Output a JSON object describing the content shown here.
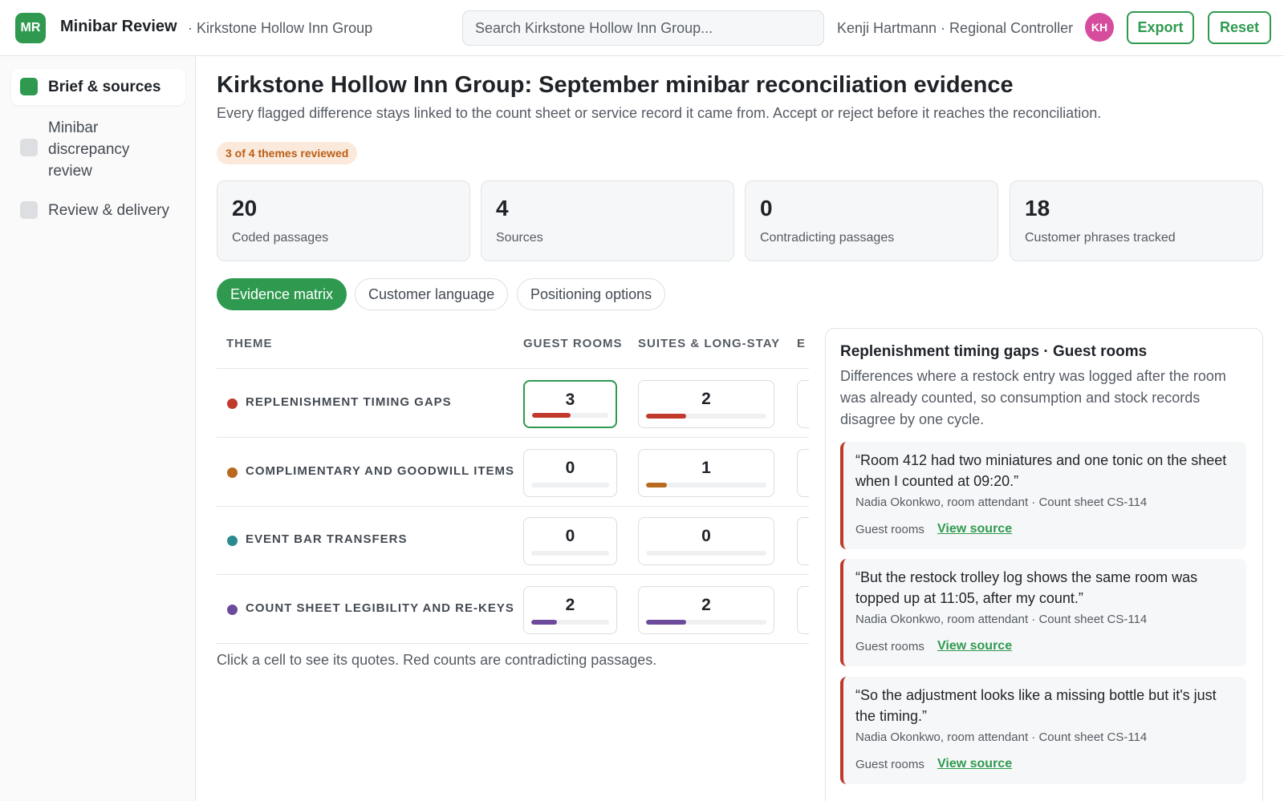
{
  "app": {
    "logo_initials": "MR",
    "title": "Minibar Review",
    "org_crumb": "· Kirkstone Hollow Inn Group",
    "search_placeholder": "Search Kirkstone Hollow Inn Group...",
    "user_label": "Kenji Hartmann · Regional Controller",
    "user_initials": "KH",
    "export_label": "Export",
    "reset_label": "Reset"
  },
  "sidebar": {
    "items": [
      {
        "label": "Brief & sources",
        "done": true,
        "active": true
      },
      {
        "label": "Minibar discrepancy review",
        "done": false,
        "active": false
      },
      {
        "label": "Review & delivery",
        "done": false,
        "active": false
      }
    ]
  },
  "page": {
    "title": "Kirkstone Hollow Inn Group: September minibar reconciliation evidence",
    "subtitle": "Every flagged difference stays linked to the count sheet or service record it came from. Accept or reject before it reaches the reconciliation.",
    "progress_badge": "3 of 4 themes reviewed"
  },
  "stats": [
    {
      "value": "20",
      "label": "Coded passages"
    },
    {
      "value": "4",
      "label": "Sources"
    },
    {
      "value": "0",
      "label": "Contradicting passages"
    },
    {
      "value": "18",
      "label": "Customer phrases tracked"
    }
  ],
  "tabs": [
    {
      "label": "Evidence matrix",
      "active": true
    },
    {
      "label": "Customer language",
      "active": false
    },
    {
      "label": "Positioning options",
      "active": false
    }
  ],
  "matrix": {
    "columns": [
      "THEME",
      "GUEST ROOMS",
      "SUITES & LONG-STAY",
      "E"
    ],
    "rows": [
      {
        "theme": "REPLENISHMENT TIMING GAPS",
        "color": "#c0392b",
        "counts": [
          "3",
          "2"
        ],
        "fill": [
          0.5,
          0.33
        ]
      },
      {
        "theme": "COMPLIMENTARY AND GOODWILL ITEMS",
        "color": "#b86a1f",
        "counts": [
          "0",
          "1"
        ],
        "fill": [
          0,
          0.17
        ]
      },
      {
        "theme": "EVENT BAR TRANSFERS",
        "color": "#2a8a8f",
        "counts": [
          "0",
          "0"
        ],
        "fill": [
          0,
          0
        ]
      },
      {
        "theme": "COUNT SHEET LEGIBILITY AND RE-KEYS",
        "color": "#6c4a9c",
        "counts": [
          "2",
          "2"
        ],
        "fill": [
          0.33,
          0.33
        ]
      }
    ],
    "hint": "Click a cell to see its quotes. Red counts are contradicting passages."
  },
  "detail": {
    "title": "Replenishment timing gaps · Guest rooms",
    "description": "Differences where a restock entry was logged after the room was already counted, so consumption and stock records disagree by one cycle.",
    "quotes": [
      {
        "text": "“Room 412 had two miniatures and one tonic on the sheet when I counted at 09:20.”",
        "source": "Nadia Okonkwo, room attendant · Count sheet CS-114",
        "tag": "Guest rooms",
        "link": "View source"
      },
      {
        "text": "“But the restock trolley log shows the same room was topped up at 11:05, after my count.”",
        "source": "Nadia Okonkwo, room attendant · Count sheet CS-114",
        "tag": "Guest rooms",
        "link": "View source"
      },
      {
        "text": "“So the adjustment looks like a missing bottle but it's just the timing.”",
        "source": "Nadia Okonkwo, room attendant · Count sheet CS-114",
        "tag": "Guest rooms",
        "link": "View source"
      }
    ]
  },
  "colors": {
    "accent": "#2f9a4f",
    "badge_bg": "#fbeadb",
    "badge_text": "#b85e17",
    "avatar": "#d64d9e",
    "contradiction": "#c0392b"
  }
}
